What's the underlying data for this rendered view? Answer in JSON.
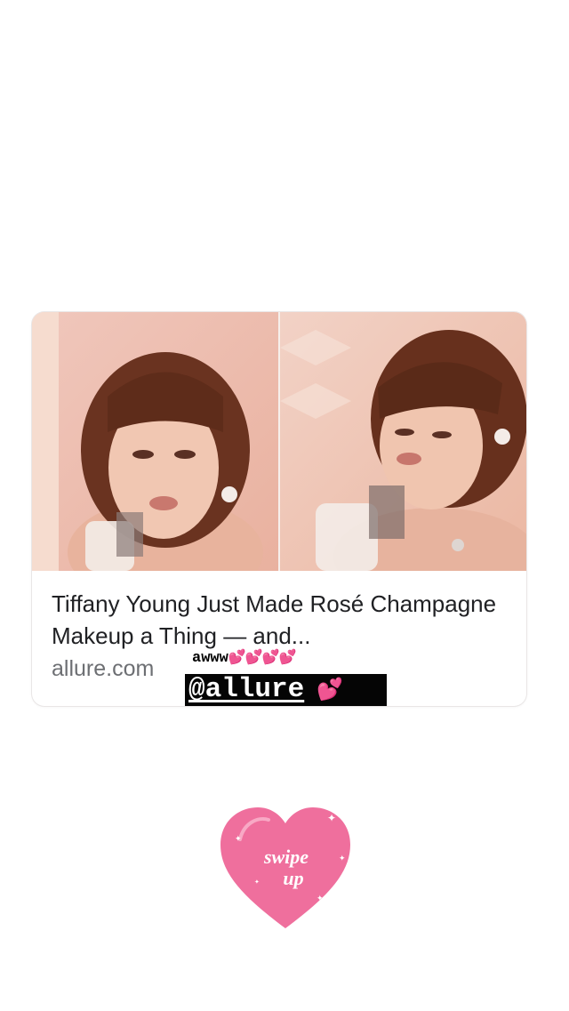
{
  "link_card": {
    "headline": "Tiffany Young Just Made Rosé Champagne Makeup a Thing — and...",
    "domain": "allure.com",
    "photos": [
      "photo-left",
      "photo-right"
    ]
  },
  "stickers": {
    "awww_text": "awww",
    "awww_hearts": "💕💕💕💕",
    "mention_handle": "@allure",
    "mention_heart": "💕"
  },
  "swipe_up": {
    "line1": "swipe",
    "line2": "up",
    "color": "#ef6f9d"
  },
  "colors": {
    "background": "#ffffff",
    "headline": "#202124",
    "domain": "#6d6f73",
    "mention_bg": "#050505"
  }
}
